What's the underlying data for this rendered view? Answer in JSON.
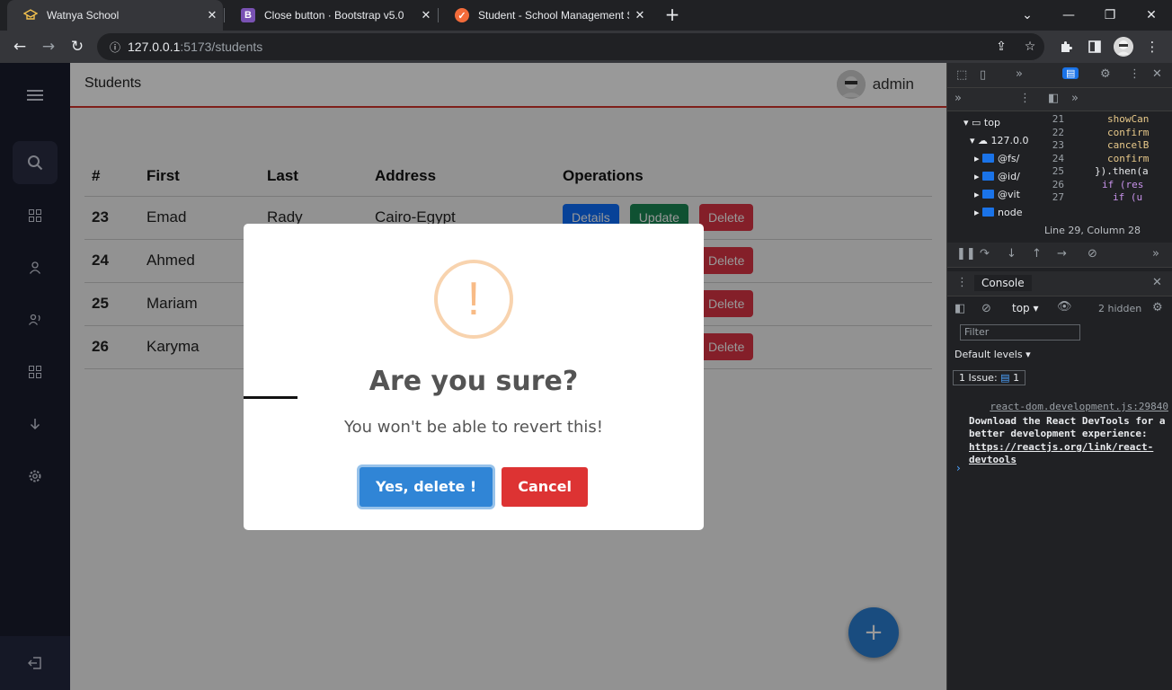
{
  "browser": {
    "tabs": [
      {
        "title": "Watnya School",
        "icon": "school-icon",
        "active": true
      },
      {
        "title": "Close button · Bootstrap v5.0",
        "icon": "bootstrap-icon",
        "active": false
      },
      {
        "title": "Student - School Management Sy",
        "icon": "app-logo-icon",
        "active": false
      }
    ],
    "tab_close_glyph": "✕",
    "new_tab_glyph": "+",
    "url_host": "127.0.0.1",
    "url_path": ":5173/students"
  },
  "app": {
    "page_title": "Students",
    "username": "admin",
    "sidebar_icons": [
      "menu-icon",
      "search-icon",
      "dashboard-icon",
      "user-icon",
      "teacher-icon",
      "grid-icon",
      "download-icon",
      "settings-icon",
      "logout-icon"
    ]
  },
  "table": {
    "headers": [
      "#",
      "First",
      "Last",
      "Address",
      "Operations"
    ],
    "rows": [
      {
        "id": "23",
        "first": "Emad",
        "last": "Rady",
        "address": "Cairo-Egypt"
      },
      {
        "id": "24",
        "first": "Ahmed",
        "last": "",
        "address": ""
      },
      {
        "id": "25",
        "first": "Mariam",
        "last": "",
        "address": ""
      },
      {
        "id": "26",
        "first": "Karyma",
        "last": "",
        "address": ""
      }
    ],
    "details_label": "Details",
    "update_label": "Update",
    "delete_label": "Delete"
  },
  "fab_glyph": "+",
  "modal": {
    "icon_glyph": "!",
    "title": "Are you sure?",
    "text": "You won't be able to revert this!",
    "confirm_label": "Yes, delete !",
    "cancel_label": "Cancel"
  },
  "devtools": {
    "tree": [
      "top",
      "127.0.0",
      "@fs/",
      "@id/",
      "@vit",
      "node"
    ],
    "code_lines": [
      {
        "n": "21",
        "t": "showCan"
      },
      {
        "n": "22",
        "t": "confirm"
      },
      {
        "n": "23",
        "t": "cancelB"
      },
      {
        "n": "24",
        "t": "confirm"
      },
      {
        "n": "25",
        "t": "}).then(a"
      },
      {
        "n": "26",
        "t": "if (res"
      },
      {
        "n": "27",
        "t": "if (u"
      }
    ],
    "status": "Line 29, Column 28",
    "console_tab": "Console",
    "context": "top",
    "hidden_count": "2 hidden",
    "filter_placeholder": "Filter",
    "levels": "Default levels",
    "issues_label": "1 Issue:",
    "issues_count": "1",
    "message_source": "react-dom.development.js:29840",
    "message_text": "Download the React DevTools for a better development experience: ",
    "message_link": "https://reactjs.org/link/react-devtools"
  },
  "colors": {
    "accent_red": "#d4342c",
    "confirm_blue": "#3085d6",
    "cancel_red": "#dd3333",
    "sidebar_bg": "#1a1d2e",
    "warning_orange": "#f8bb86"
  }
}
